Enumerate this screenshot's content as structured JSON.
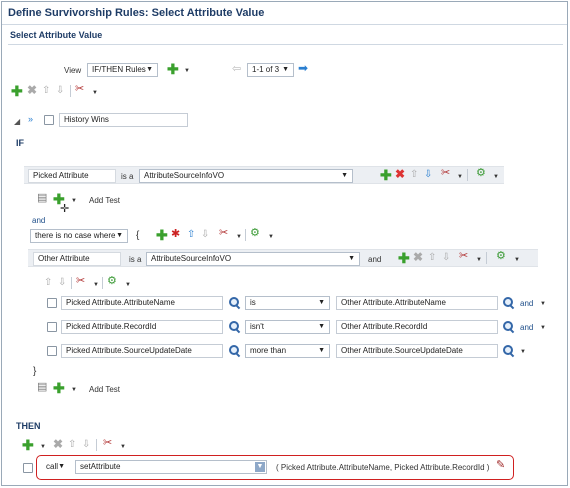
{
  "header": {
    "title": "Define Survivorship Rules: Select Attribute Value",
    "subtitle": "Select Attribute Value"
  },
  "view_bar": {
    "view_label": "View",
    "view_value": "IF/THEN Rules",
    "pager_value": "1-1 of 3"
  },
  "rule": {
    "name": "History Wins"
  },
  "if_section": {
    "heading": "IF",
    "picked": {
      "name": "Picked Attribute",
      "is_a": "is a",
      "type": "AttributeSourceInfoVO"
    },
    "add_test_label": "Add Test",
    "and_label": "and",
    "case_value": "there is no case where",
    "open_brace": "{",
    "close_brace": "}",
    "other": {
      "name": "Other Attribute",
      "is_a": "is a",
      "type": "AttributeSourceInfoVO",
      "and_label": "and"
    },
    "tests": [
      {
        "left": "Picked Attribute.AttributeName",
        "op": "is",
        "right": "Other Attribute.AttributeName",
        "conj": "and"
      },
      {
        "left": "Picked Attribute.RecordId",
        "op": "isn't",
        "right": "Other Attribute.RecordId",
        "conj": "and"
      },
      {
        "left": "Picked Attribute.SourceUpdateDate",
        "op": "more than",
        "right": "Other Attribute.SourceUpdateDate",
        "conj": ""
      }
    ],
    "add_test_label_2": "Add Test"
  },
  "then_section": {
    "heading": "THEN",
    "action": "call",
    "function": "setAttribute",
    "args": "( Picked Attribute.AttributeName, Picked Attribute.RecordId )"
  }
}
